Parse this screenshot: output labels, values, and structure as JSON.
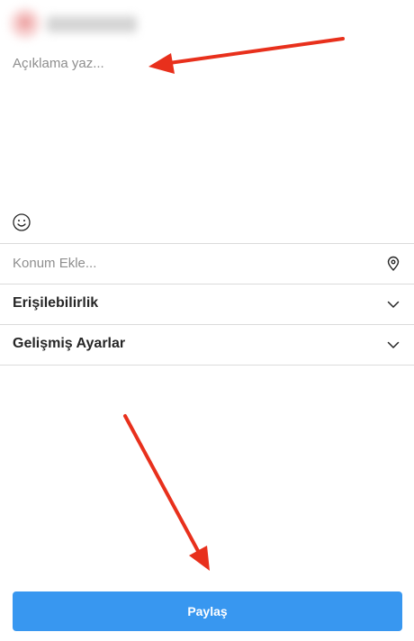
{
  "post": {
    "caption_placeholder": "Açıklama yaz...",
    "location_placeholder": "Konum Ekle...",
    "accessibility_label": "Erişilebilirlik",
    "advanced_settings_label": "Gelişmiş Ayarlar",
    "share_label": "Paylaş"
  },
  "icons": {
    "emoji": "smiley-icon",
    "location": "location-pin-icon",
    "expand": "chevron-down-icon"
  },
  "colors": {
    "share_button": "#3897f0",
    "annotation_arrow": "#e8301c",
    "divider": "#dbdbdb",
    "placeholder_text": "#8e8e8e"
  }
}
